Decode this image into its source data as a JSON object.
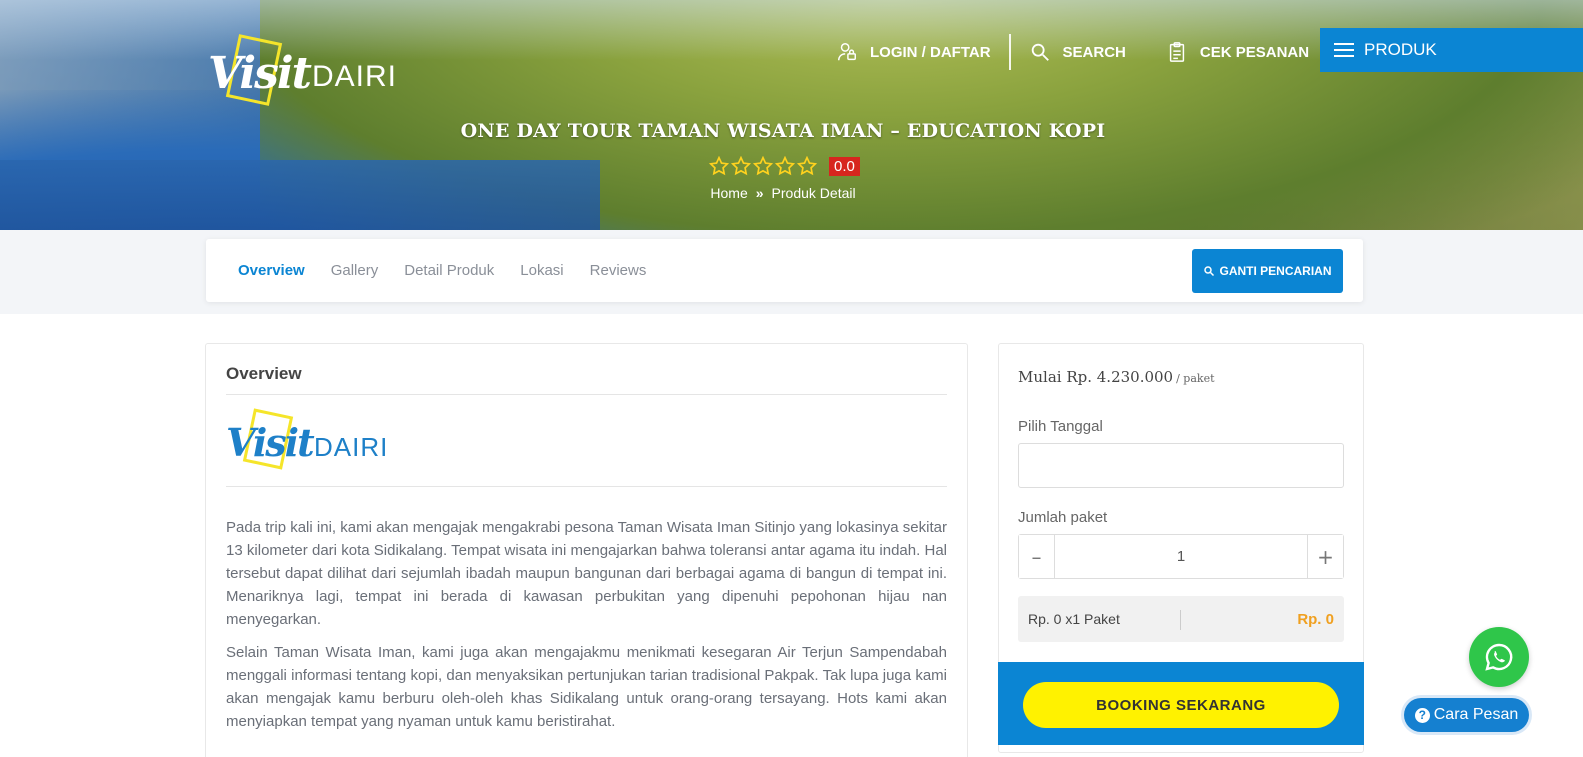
{
  "header": {
    "logo_script": "Visit",
    "logo_text": "DAIRI",
    "nav": {
      "login_label": "LOGIN / DAFTAR",
      "search_label": "SEARCH",
      "cek_label": "CEK PESANAN",
      "produk_label": "PRODUK"
    }
  },
  "hero": {
    "title": "ONE DAY TOUR TAMAN WISATA IMAN – EDUCATION KOPI",
    "rating_value": "0.0",
    "stars_filled": 0,
    "stars_total": 5,
    "breadcrumb": {
      "home": "Home",
      "separator": "»",
      "current": "Produk Detail"
    }
  },
  "tabs": {
    "items": [
      "Overview",
      "Gallery",
      "Detail Produk",
      "Lokasi",
      "Reviews"
    ],
    "active": "Overview",
    "ganti_label": "GANTI PENCARIAN"
  },
  "overview": {
    "heading": "Overview",
    "logo_script": "Visit",
    "logo_text": "DAIRI",
    "paragraph1": "Pada trip kali ini, kami akan mengajak mengakrabi pesona Taman Wisata Iman Sitinjo yang lokasinya sekitar 13 kilometer dari kota Sidikalang. Tempat wisata ini mengajarkan bahwa toleransi antar agama itu indah. Hal tersebut dapat dilihat dari sejumlah ibadah maupun bangunan dari berbagai agama di bangun di tempat ini.  Menariknya lagi, tempat ini berada di kawasan perbukitan yang dipenuhi pepohonan hijau nan menyegarkan.",
    "paragraph2": "Selain Taman Wisata Iman, kami juga akan mengajakmu menikmati kesegaran Air Terjun Sampendabah menggali informasi tentang kopi, dan menyaksikan pertunjukan tarian tradisional Pakpak. Tak lupa juga kami akan mengajak kamu berburu oleh-oleh khas Sidikalang untuk orang-orang tersayang. Hots kami akan menyiapkan tempat yang nyaman untuk kamu beristirahat."
  },
  "booking": {
    "price_label": "Mulai Rp. 4.230.000",
    "price_unit": "/ paket",
    "date_label": "Pilih Tanggal",
    "date_value": "",
    "qty_label": "Jumlah paket",
    "qty_value": "1",
    "minus": "–",
    "plus": "+",
    "subtotal_left": "Rp. 0 x1 Paket",
    "subtotal_right": "Rp. 0",
    "book_label": "BOOKING SEKARANG"
  },
  "floating": {
    "whatsapp_icon": "whatsapp-icon",
    "cara_label": "Cara Pesan",
    "cara_q": "?"
  },
  "colors": {
    "primary": "#0b85d3",
    "book_button": "#fff200",
    "rating_badge": "#d7261e",
    "whatsapp": "#2fc64a",
    "subtotal_price": "#f0a020"
  }
}
